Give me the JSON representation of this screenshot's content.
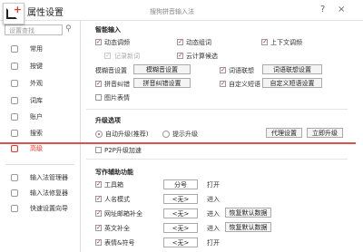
{
  "window": {
    "title": "属性设置",
    "app_name": "搜狗拼音输入法",
    "help_label": "?",
    "close_label": "×"
  },
  "sidebar": {
    "search_placeholder": "设置查找",
    "items": [
      {
        "label": "常用"
      },
      {
        "label": "按键"
      },
      {
        "label": "外观"
      },
      {
        "label": "词库"
      },
      {
        "label": "账户"
      },
      {
        "label": "搜索"
      },
      {
        "label": "高级"
      }
    ],
    "bottom_items": [
      {
        "label": "输入法管理器"
      },
      {
        "label": "输入法修复器"
      },
      {
        "label": "快速设置向导"
      }
    ]
  },
  "smart_input": {
    "heading": "智能输入",
    "dynamic_adjust": "动态调频",
    "dynamic_phrase": "动态组词",
    "context_predict": "上下文调频",
    "remember_new": "记录新词",
    "cloud_compute": "云计算候选",
    "fuzzy_label": "模糊音设置",
    "fuzzy_button": "模糊音设置",
    "word_assoc": "词语联想",
    "word_assoc_button": "词语联想设置",
    "pinyin_correct": "拼音纠错",
    "pinyin_correct_button": "拼音纠错设置",
    "custom_phrase": "自定义短语",
    "custom_phrase_button": "自定义短语设置",
    "picture_expression": "图片表情"
  },
  "upgrade": {
    "heading": "升级选项",
    "auto_upgrade": "自动升级(推荐)",
    "notify_upgrade": "提示升级",
    "proxy_button": "代理设置",
    "upgrade_now_button": "立即升级",
    "p2p": "P2P升级加速"
  },
  "writing": {
    "heading": "写作辅助功能",
    "rows": [
      {
        "label": "工具箱",
        "key": "分号",
        "action": "打开",
        "button": ""
      },
      {
        "label": "人名模式",
        "key": "<无>",
        "action": "进入",
        "button": ""
      },
      {
        "label": "网址邮箱补全",
        "key": "<无>",
        "action": "进入",
        "button": "恢复默认数据"
      },
      {
        "label": "英文补全",
        "key": "<无>",
        "action": "进入",
        "button": "恢复默认数据"
      },
      {
        "label": "表情&符号",
        "key": "<无>",
        "action": "打开",
        "button": ""
      }
    ]
  },
  "colors": {
    "accent": "#e03a2c",
    "highlight_line": "#d9534f"
  }
}
